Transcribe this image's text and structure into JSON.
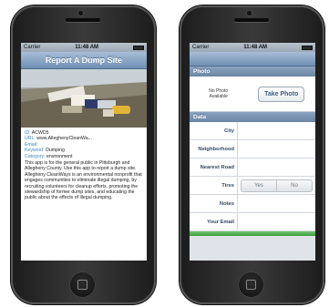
{
  "left_phone": {
    "status": {
      "carrier": "Carrier",
      "time": "11:48 AM"
    },
    "nav_title": "Report A Dump Site",
    "info": {
      "id_label": "ID:",
      "id_value": "ACWD5",
      "url_label": "URL:",
      "url_value": "www.AlleghenyCleanWa...",
      "email_label": "Email:",
      "email_value": "",
      "keyword_label": "Keyword:",
      "keyword_value": "Dumping",
      "category_label": "Category:",
      "category_value": "environment",
      "description": "This app is for the general public in Pittsburgh and Allegheny County. Use this app to report a dump site. Allegheny CleanWays is an environmental nonprofit that engages communities to eliminate illegal dumping, by recruiting volunteers for cleanup efforts, promoting the stewardship of former dump sites, and educating the public about the effects of illegal dumping."
    }
  },
  "right_phone": {
    "status": {
      "carrier": "Carrier",
      "time": "11:48 AM"
    },
    "photo_section": {
      "header": "Photo",
      "no_photo_text": "No Photo Available",
      "take_photo_label": "Take Photo"
    },
    "data_section": {
      "header": "Data",
      "fields": {
        "city": "City",
        "neighborhood": "Neighborhood",
        "nearest_road": "Nearest Road",
        "tires": "Tires",
        "notes": "Notes",
        "your_email": "Your Email"
      },
      "tires_options": {
        "yes": "Yes",
        "no": "No"
      }
    }
  },
  "colors": {
    "nav_bar": "#6f8fb4",
    "link_blue": "#3f86c9",
    "section_header": "#7a93b1",
    "submit_green": "#4aa84a"
  }
}
